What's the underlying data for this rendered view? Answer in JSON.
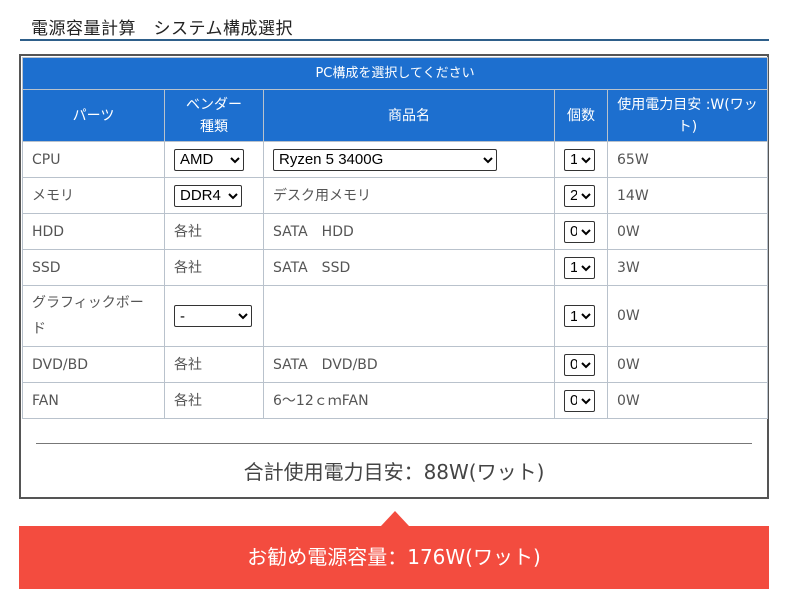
{
  "page_title": "電源容量計算　システム構成選択",
  "table": {
    "caption": "PC構成を選択してください",
    "headers": {
      "parts": "パーツ",
      "vendor_line1": "ベンダー",
      "vendor_line2": "種類",
      "product": "商品名",
      "count": "個数",
      "power": "使用電力目安 :W(ワット)"
    },
    "rows": [
      {
        "part": "CPU",
        "vendor": "AMD",
        "product": "Ryzen 5 3400G",
        "count": "1",
        "power": "65W"
      },
      {
        "part": "メモリ",
        "vendor": "DDR4",
        "product": "デスク用メモリ",
        "count": "2",
        "power": "14W"
      },
      {
        "part": "HDD",
        "vendor": "各社",
        "product": "SATA　HDD",
        "count": "0",
        "power": "0W"
      },
      {
        "part": "SSD",
        "vendor": "各社",
        "product": "SATA　SSD",
        "count": "1",
        "power": "3W"
      },
      {
        "part": "グラフィックボード",
        "vendor": "-",
        "product": "",
        "count": "1",
        "power": "0W"
      },
      {
        "part": "DVD/BD",
        "vendor": "各社",
        "product": "SATA　DVD/BD",
        "count": "0",
        "power": "0W"
      },
      {
        "part": "FAN",
        "vendor": "各社",
        "product": "6～12ｃｍFAN",
        "count": "0",
        "power": "0W"
      }
    ]
  },
  "total_text": "合計使用電力目安：88W(ワット)",
  "recommend_text": "お勧め電源容量：176W(ワット)",
  "colors": {
    "header_blue": "#1d6fcf",
    "heading_underline": "#2e5f8a",
    "recommend_red": "#f34c3f"
  }
}
